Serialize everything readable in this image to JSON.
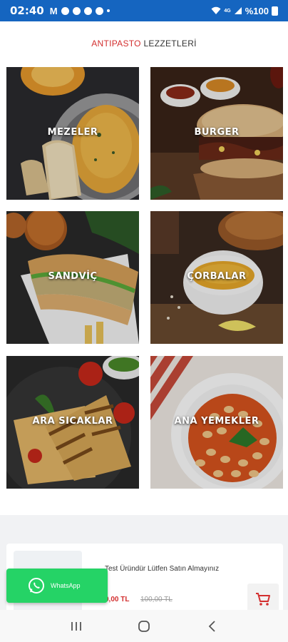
{
  "status_bar": {
    "time": "02:40",
    "battery": "%100",
    "network": "4G"
  },
  "header": {
    "title_accent": "ANTIPASTO",
    "title_rest": " LEZZETLERİ",
    "accent_color": "#d32f2f"
  },
  "categories": [
    {
      "label": "MEZELER",
      "icon": "meze-photo"
    },
    {
      "label": "BURGER",
      "icon": "burger-photo"
    },
    {
      "label": "SANDVİÇ",
      "icon": "sandwich-photo"
    },
    {
      "label": "ÇORBALAR",
      "icon": "soup-photo"
    },
    {
      "label": "ARA SICAKLAR",
      "icon": "wrap-photo"
    },
    {
      "label": "ANA YEMEKLER",
      "icon": "beans-photo"
    }
  ],
  "product": {
    "name": "Test Üründür Lütfen Satın Almayınız",
    "price": "0,00 TL",
    "old_price": "100,00 TL"
  },
  "whatsapp": {
    "label": "WhatsApp",
    "color": "#25d366"
  },
  "navbar": {
    "icons": [
      "recent-apps-icon",
      "home-icon",
      "back-icon"
    ]
  }
}
